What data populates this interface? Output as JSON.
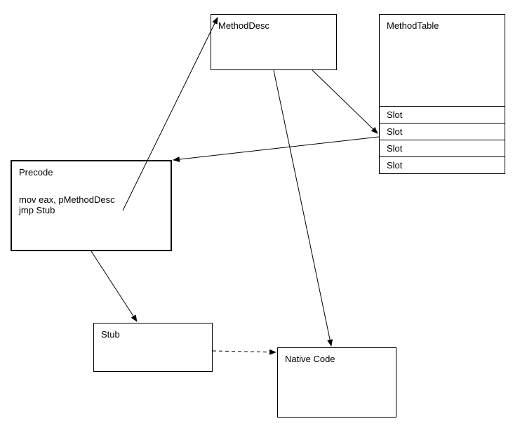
{
  "boxes": {
    "methoddesc": {
      "label": "MethodDesc"
    },
    "methodtable": {
      "label": "MethodTable",
      "slots": [
        "Slot",
        "Slot",
        "Slot",
        "Slot"
      ]
    },
    "precode": {
      "label": "Precode",
      "code_line1": "mov eax, pMethodDesc",
      "code_line2": "jmp Stub"
    },
    "stub": {
      "label": "Stub"
    },
    "nativecode": {
      "label": "Native Code"
    }
  }
}
